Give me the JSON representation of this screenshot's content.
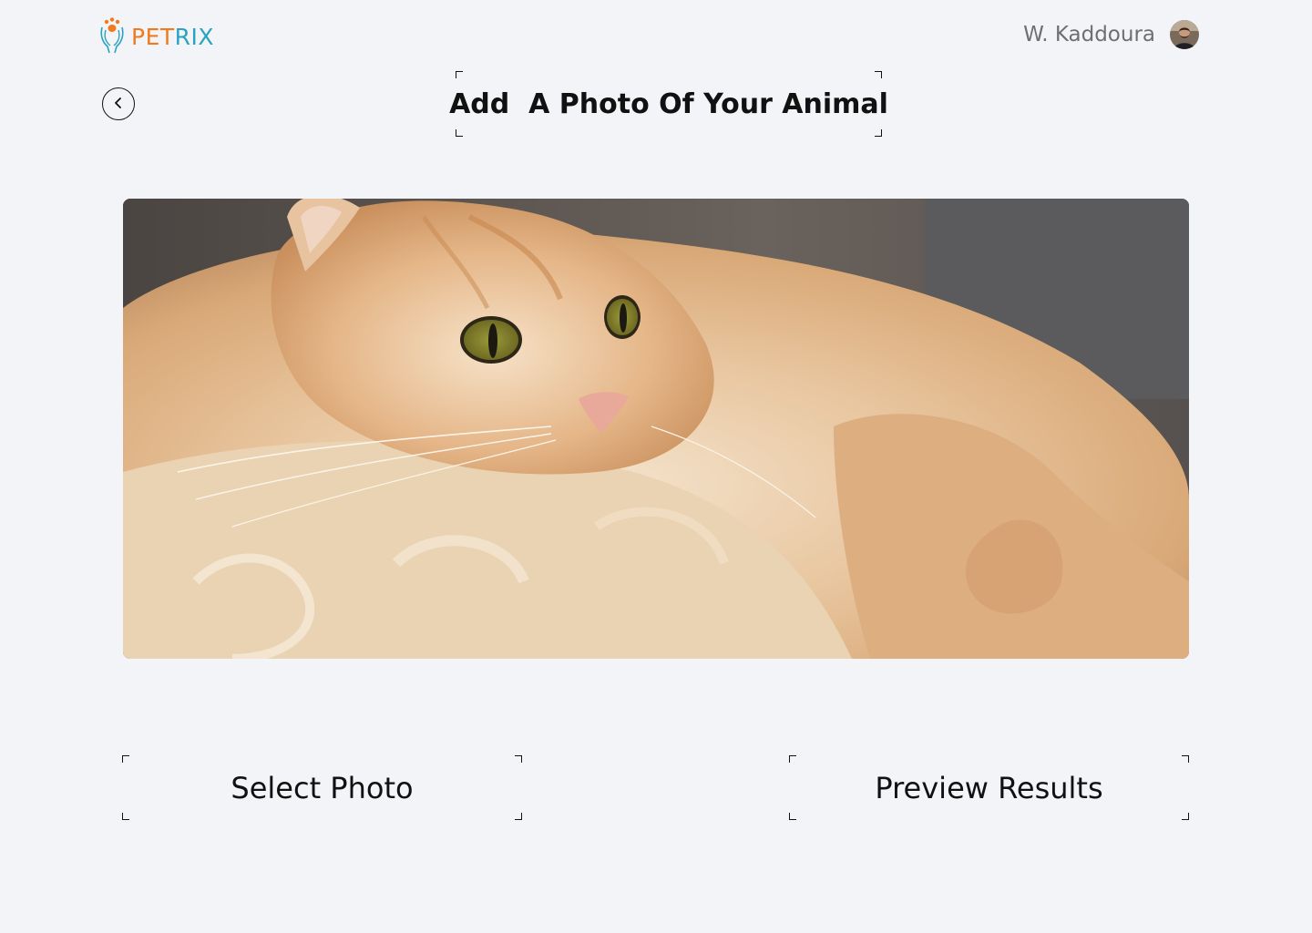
{
  "header": {
    "brand_part1": "PET",
    "brand_part2": "RIX",
    "user_name": "W. Kaddoura",
    "logo_icon": "paw-hands-icon",
    "avatar_icon": "user-avatar"
  },
  "page": {
    "title": "Add  A Photo Of Your Animal",
    "back_icon": "chevron-left-icon"
  },
  "photo": {
    "subject": "cat-photo"
  },
  "actions": {
    "select_label": "Select Photo",
    "preview_label": "Preview Results"
  },
  "colors": {
    "background": "#f3f4f8",
    "brand_orange": "#f07a1e",
    "brand_teal": "#2aa3c2",
    "text_dark": "#111111",
    "text_muted": "#6f6f6f"
  }
}
